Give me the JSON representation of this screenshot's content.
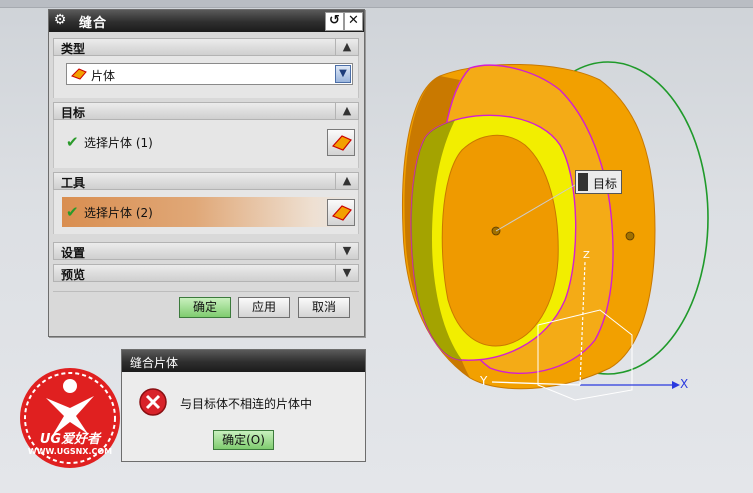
{
  "sew_dialog": {
    "title": "缝合",
    "type_section": {
      "label": "类型",
      "selected": "片体"
    },
    "target_section": {
      "label": "目标",
      "select_text": "选择片体 (1)"
    },
    "tool_section": {
      "label": "工具",
      "select_text": "选择片体 (2)"
    },
    "settings_section": {
      "label": "设置"
    },
    "preview_section": {
      "label": "预览"
    },
    "buttons": {
      "ok": "确定",
      "apply": "应用",
      "cancel": "取消"
    }
  },
  "error_dialog": {
    "title": "缝合片体",
    "message": "与目标体不相连的片体中",
    "ok_label": "确定(O)"
  },
  "viewport": {
    "tooltip": "目标",
    "axis_x": "X",
    "axis_y": "Y",
    "axis_z": "Z",
    "colors": {
      "body_orange": "#f4a300",
      "inner_yellow": "#f2ee00",
      "edge_magenta": "#d21ed2",
      "curve_green": "#1f9a2a"
    }
  },
  "watermark": {
    "brand": "UG爱好者",
    "url": "WWW.UGSNX.COM"
  }
}
